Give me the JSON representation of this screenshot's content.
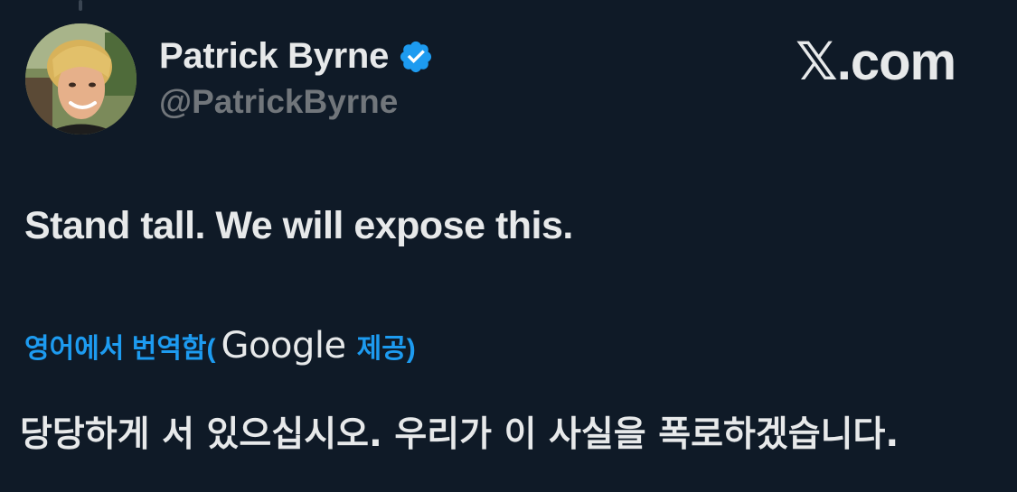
{
  "author": {
    "display_name": "Patrick Byrne",
    "handle": "@PatrickByrne",
    "verified": true
  },
  "brand": {
    "mark": "𝕏",
    "suffix": ".com"
  },
  "tweet": {
    "text": "Stand tall. We will expose this."
  },
  "translation": {
    "prefix": "영어에서 번역함(",
    "provider": "Google",
    "suffix": "제공)",
    "text": "당당하게 서 있으십시오. 우리가 이 사실을 폭로하겠습니다."
  },
  "colors": {
    "background": "#0f1a27",
    "text": "#e7e9ea",
    "secondary": "#71767b",
    "accent": "#1d9bf0"
  },
  "icons": {
    "verified": "verified-badge-icon"
  }
}
